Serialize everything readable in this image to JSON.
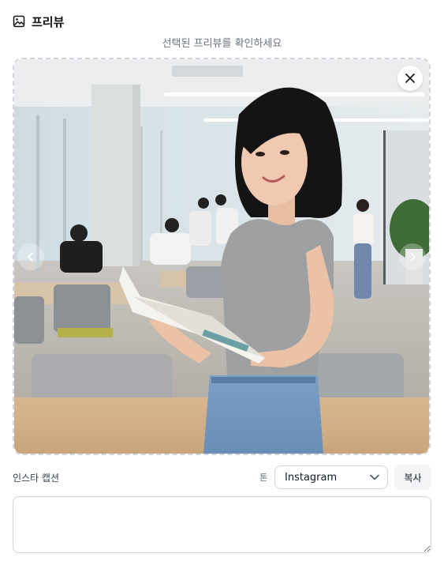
{
  "header": {
    "title": "프리뷰",
    "icon": "image-icon"
  },
  "subtitle": "선택된 프리뷰를 확인하세요",
  "preview": {
    "close_icon": "close-icon",
    "prev_icon": "chevron-left-icon",
    "next_icon": "chevron-right-icon"
  },
  "caption": {
    "label": "인스타 캡션",
    "tone_label": "톤",
    "platform_selected": "Instagram",
    "copy_label": "복사",
    "text_value": "",
    "text_placeholder": ""
  },
  "colors": {
    "border": "#d1d5db",
    "subtitle": "#6b7280",
    "button_bg": "#f3f4f6"
  }
}
